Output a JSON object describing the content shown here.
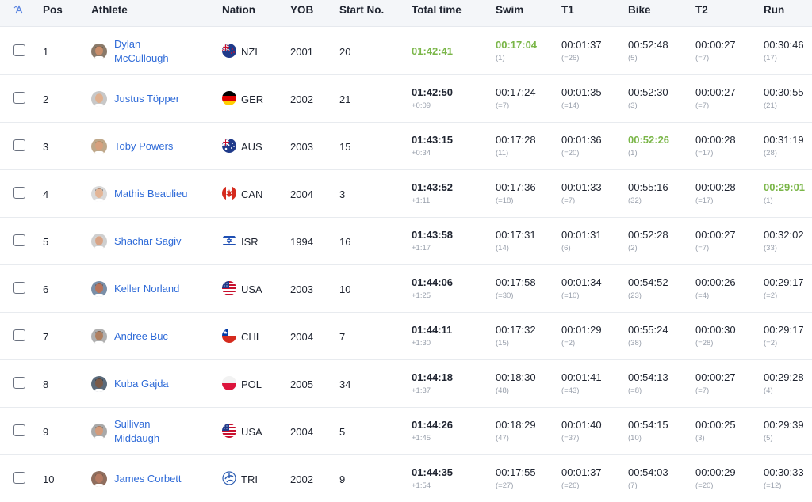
{
  "header": {
    "pos": "Pos",
    "athlete": "Athlete",
    "nation": "Nation",
    "yob": "YOB",
    "start_no": "Start No.",
    "total_time": "Total time",
    "swim": "Swim",
    "t1": "T1",
    "bike": "Bike",
    "t2": "T2",
    "run": "Run"
  },
  "colors": {
    "link": "#2f6bd8",
    "best": "#7ab648",
    "header_bg": "#f4f6f9",
    "muted": "#9aa1ad"
  },
  "rows": [
    {
      "pos": "1",
      "first": "Dylan",
      "last": "McCullough",
      "nation": "NZL",
      "yob": "2001",
      "start": "20",
      "total": "01:42:41",
      "gap": "",
      "swim": "00:17:04",
      "swim_rank": "(1)",
      "t1": "00:01:37",
      "t1_rank": "(=26)",
      "bike": "00:52:48",
      "bike_rank": "(5)",
      "t2": "00:00:27",
      "t2_rank": "(=7)",
      "run": "00:30:46",
      "run_rank": "(17)",
      "best": [
        "total",
        "swim"
      ]
    },
    {
      "pos": "2",
      "first": "Justus Töpper",
      "last": "",
      "nation": "GER",
      "yob": "2002",
      "start": "21",
      "total": "01:42:50",
      "gap": "+0:09",
      "swim": "00:17:24",
      "swim_rank": "(=7)",
      "t1": "00:01:35",
      "t1_rank": "(=14)",
      "bike": "00:52:30",
      "bike_rank": "(3)",
      "t2": "00:00:27",
      "t2_rank": "(=7)",
      "run": "00:30:55",
      "run_rank": "(21)",
      "best": []
    },
    {
      "pos": "3",
      "first": "Toby Powers",
      "last": "",
      "nation": "AUS",
      "yob": "2003",
      "start": "15",
      "total": "01:43:15",
      "gap": "+0:34",
      "swim": "00:17:28",
      "swim_rank": "(11)",
      "t1": "00:01:36",
      "t1_rank": "(=20)",
      "bike": "00:52:26",
      "bike_rank": "(1)",
      "t2": "00:00:28",
      "t2_rank": "(=17)",
      "run": "00:31:19",
      "run_rank": "(28)",
      "best": [
        "bike"
      ]
    },
    {
      "pos": "4",
      "first": "Mathis Beaulieu",
      "last": "",
      "nation": "CAN",
      "yob": "2004",
      "start": "3",
      "total": "01:43:52",
      "gap": "+1:11",
      "swim": "00:17:36",
      "swim_rank": "(=18)",
      "t1": "00:01:33",
      "t1_rank": "(=7)",
      "bike": "00:55:16",
      "bike_rank": "(32)",
      "t2": "00:00:28",
      "t2_rank": "(=17)",
      "run": "00:29:01",
      "run_rank": "(1)",
      "best": [
        "run"
      ]
    },
    {
      "pos": "5",
      "first": "Shachar Sagiv",
      "last": "",
      "nation": "ISR",
      "yob": "1994",
      "start": "16",
      "total": "01:43:58",
      "gap": "+1:17",
      "swim": "00:17:31",
      "swim_rank": "(14)",
      "t1": "00:01:31",
      "t1_rank": "(6)",
      "bike": "00:52:28",
      "bike_rank": "(2)",
      "t2": "00:00:27",
      "t2_rank": "(=7)",
      "run": "00:32:02",
      "run_rank": "(33)",
      "best": []
    },
    {
      "pos": "6",
      "first": "Keller Norland",
      "last": "",
      "nation": "USA",
      "yob": "2003",
      "start": "10",
      "total": "01:44:06",
      "gap": "+1:25",
      "swim": "00:17:58",
      "swim_rank": "(=30)",
      "t1": "00:01:34",
      "t1_rank": "(=10)",
      "bike": "00:54:52",
      "bike_rank": "(23)",
      "t2": "00:00:26",
      "t2_rank": "(=4)",
      "run": "00:29:17",
      "run_rank": "(=2)",
      "best": []
    },
    {
      "pos": "7",
      "first": "Andree Buc",
      "last": "",
      "nation": "CHI",
      "yob": "2004",
      "start": "7",
      "total": "01:44:11",
      "gap": "+1:30",
      "swim": "00:17:32",
      "swim_rank": "(15)",
      "t1": "00:01:29",
      "t1_rank": "(=2)",
      "bike": "00:55:24",
      "bike_rank": "(38)",
      "t2": "00:00:30",
      "t2_rank": "(=28)",
      "run": "00:29:17",
      "run_rank": "(=2)",
      "best": []
    },
    {
      "pos": "8",
      "first": "Kuba Gajda",
      "last": "",
      "nation": "POL",
      "yob": "2005",
      "start": "34",
      "total": "01:44:18",
      "gap": "+1:37",
      "swim": "00:18:30",
      "swim_rank": "(48)",
      "t1": "00:01:41",
      "t1_rank": "(=43)",
      "bike": "00:54:13",
      "bike_rank": "(=8)",
      "t2": "00:00:27",
      "t2_rank": "(=7)",
      "run": "00:29:28",
      "run_rank": "(4)",
      "best": []
    },
    {
      "pos": "9",
      "first": "Sullivan",
      "last": "Middaugh",
      "nation": "USA",
      "yob": "2004",
      "start": "5",
      "total": "01:44:26",
      "gap": "+1:45",
      "swim": "00:18:29",
      "swim_rank": "(47)",
      "t1": "00:01:40",
      "t1_rank": "(=37)",
      "bike": "00:54:15",
      "bike_rank": "(10)",
      "t2": "00:00:25",
      "t2_rank": "(3)",
      "run": "00:29:39",
      "run_rank": "(5)",
      "best": []
    },
    {
      "pos": "10",
      "first": "James Corbett",
      "last": "",
      "nation": "TRI",
      "yob": "2002",
      "start": "9",
      "total": "01:44:35",
      "gap": "+1:54",
      "swim": "00:17:55",
      "swim_rank": "(=27)",
      "t1": "00:01:37",
      "t1_rank": "(=26)",
      "bike": "00:54:03",
      "bike_rank": "(7)",
      "t2": "00:00:29",
      "t2_rank": "(=20)",
      "run": "00:30:33",
      "run_rank": "(=12)",
      "best": []
    }
  ]
}
